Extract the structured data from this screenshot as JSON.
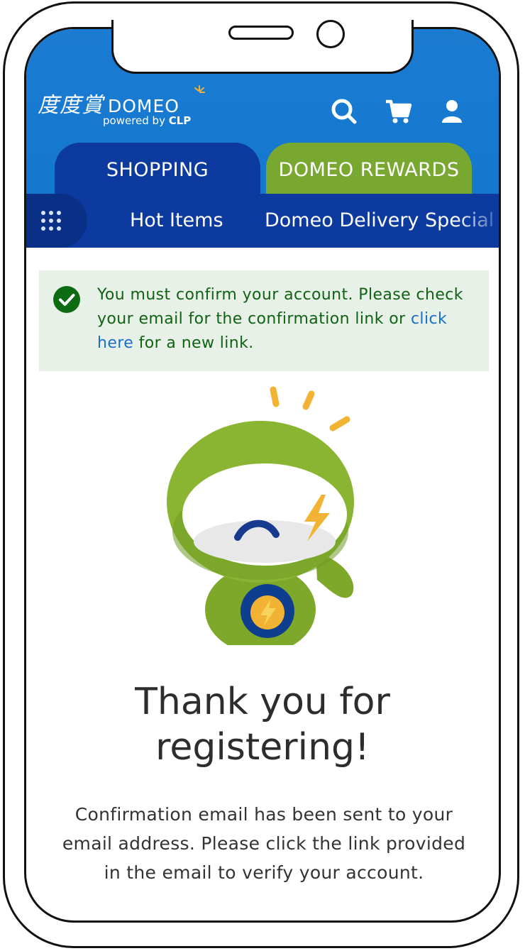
{
  "header": {
    "logo_chinese": "度度賞",
    "logo_brand": "DOMEO",
    "logo_powered_prefix": "powered by",
    "logo_powered_brand": "CLP",
    "icons": [
      "search-icon",
      "cart-icon",
      "user-icon"
    ],
    "bg_color": "#1478cf"
  },
  "tabs": [
    {
      "label": "SHOPPING",
      "color": "#0d3a9f",
      "active": true
    },
    {
      "label": "DOMEO REWARDS",
      "color": "#79a830",
      "active": false
    }
  ],
  "subnav": {
    "menu_icon": "grid-menu-icon",
    "items": [
      "Hot Items",
      "Domeo Delivery Special"
    ]
  },
  "alert": {
    "icon": "check-circle-icon",
    "text_before": "You must confirm your account. Please check your email for the confirmation link or ",
    "link_text": "click here",
    "text_after": " for a new link.",
    "bg_color": "#e7f1e7",
    "text_color": "#116214"
  },
  "main": {
    "mascot": "domeo-mascot-image",
    "title": "Thank you for registering!",
    "description": "Confirmation email has been sent to your email address. Please click the link provided in the email to verify your account."
  }
}
